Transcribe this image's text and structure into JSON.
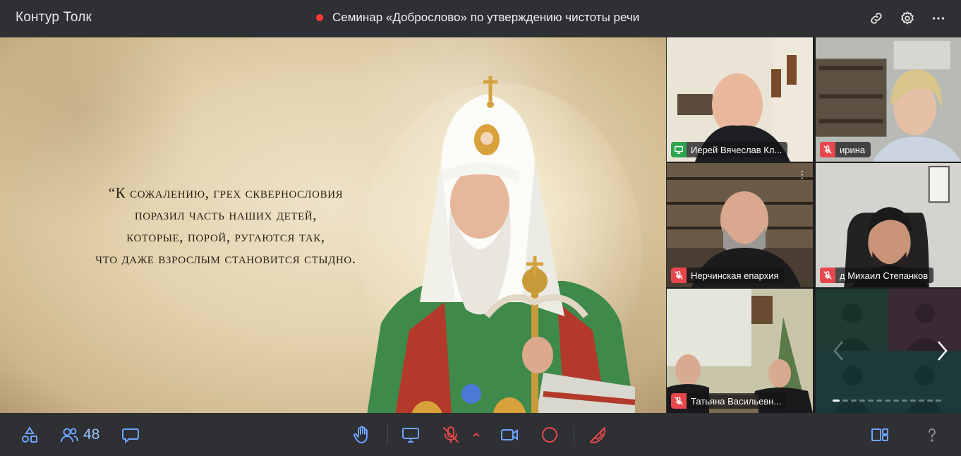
{
  "app": {
    "brand": "Контур Толк",
    "meeting_title": "Семинар «Доброслово» по утверждению чистоты речи"
  },
  "colors": {
    "accent": "#1f7bff",
    "recording": "#ff3b30",
    "muted": "#e5484d",
    "sharing": "#2ea44f",
    "icon": "#6fa4ff"
  },
  "stage": {
    "quote_lines": [
      "“К сожалению, грех сквернословия",
      "поразил часть наших детей,",
      "которые, порой, ругаются так,",
      "что даже взрослым становится стыдно."
    ]
  },
  "participants": [
    {
      "name": "Иерей Вячеслав Кл...",
      "status": "sharing-icon",
      "active": true
    },
    {
      "name": "ирина",
      "status": "mic-off-icon"
    },
    {
      "name": "Нерчинская епархия",
      "status": "mic-off-icon"
    },
    {
      "name": "д Михаил Степанков",
      "status": "mic-off-icon"
    },
    {
      "name": "Татьяна Васильевн...",
      "status": "mic-off-icon"
    }
  ],
  "bottom": {
    "participants_count": "48"
  }
}
